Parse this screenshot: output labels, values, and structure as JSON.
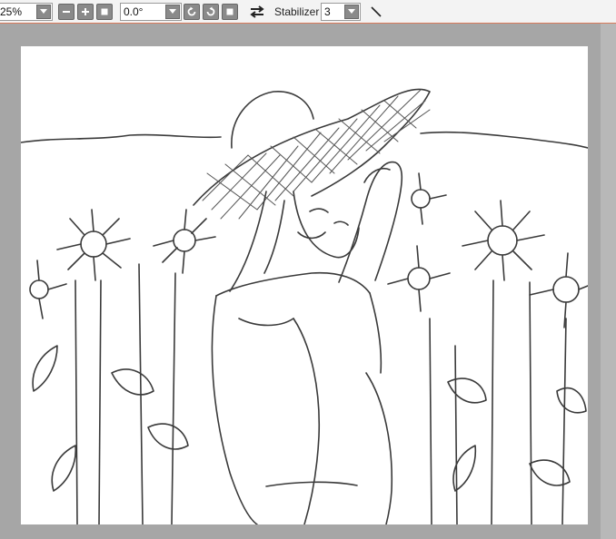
{
  "toolbar": {
    "zoom": {
      "value": "25%"
    },
    "zoom_out_icon": "minus-icon",
    "zoom_in_icon": "plus-icon",
    "zoom_fit_icon": "square-icon",
    "rotation": {
      "value": "0.0°"
    },
    "rotate_ccw_icon": "rotate-left-icon",
    "rotate_cw_icon": "rotate-right-icon",
    "rotate_reset_icon": "square-icon",
    "flip_icon": "flip-horizontal-icon",
    "stabilizer": {
      "label": "Stabilizer",
      "value": "3"
    },
    "pen_icon": "diagonal-line-icon"
  },
  "canvas": {
    "content": "line-art sketch of a person in a straw hat among sunflowers"
  },
  "colors": {
    "toolbar_bg": "#f3f3f3",
    "canvas_bg": "#a6a6a6",
    "paper": "#ffffff",
    "button": "#8a8a8a",
    "accent_border": "#d97a5a"
  }
}
